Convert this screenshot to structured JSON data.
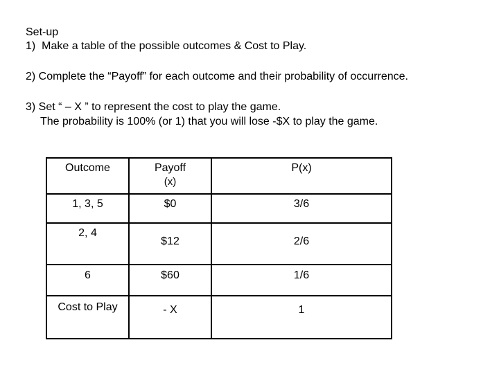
{
  "instructions": {
    "title": "Set-up",
    "step1": "1)  Make a table of the possible outcomes & Cost to Play.",
    "step2": "2) Complete the “Payoff” for each outcome and their probability of occurrence.",
    "step3": "3) Set “ – X ” to represent the cost to play the game.",
    "step3_detail": "The probability is 100% (or 1) that you will lose -$X to play the game."
  },
  "table": {
    "headers": {
      "outcome": "Outcome",
      "payoff": "Payoff",
      "payoff_sub": "(x)",
      "prob": "P(x)"
    },
    "rows": [
      {
        "outcome": "1, 3, 5",
        "payoff": "$0",
        "prob": "3/6"
      },
      {
        "outcome": "2, 4",
        "payoff": "$12",
        "prob": "2/6"
      },
      {
        "outcome": "6",
        "payoff": "$60",
        "prob": "1/6"
      },
      {
        "outcome": "Cost to Play",
        "payoff": "- X",
        "prob": "1"
      }
    ]
  }
}
